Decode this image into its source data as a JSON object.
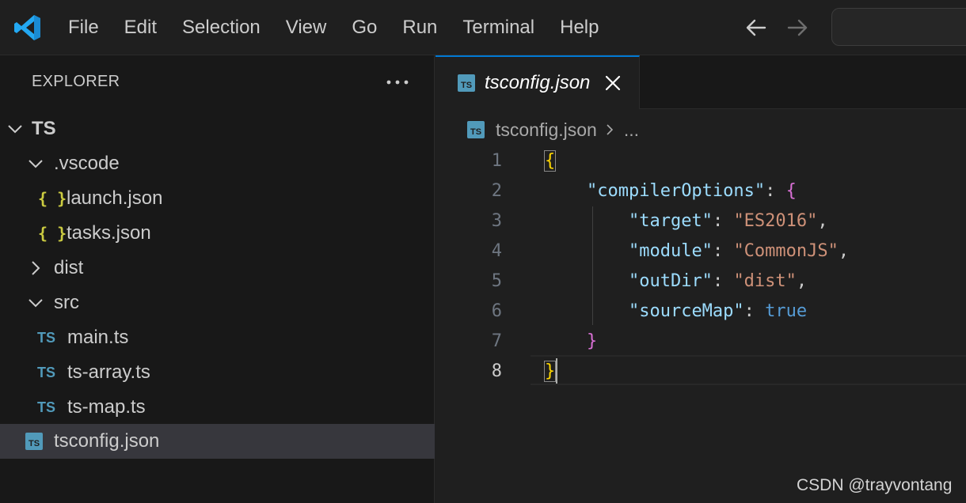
{
  "menu": {
    "items": [
      "File",
      "Edit",
      "Selection",
      "View",
      "Go",
      "Run",
      "Terminal",
      "Help"
    ]
  },
  "icons": {
    "app": "vscode-logo-icon",
    "back": "arrow-left-icon",
    "forward": "arrow-right-icon",
    "more": "ellipsis-icon",
    "close": "close-icon"
  },
  "colors": {
    "accent": "#0078d4",
    "json_icon": "#cbcb41",
    "ts_icon": "#519aba",
    "string": "#ce9178",
    "key": "#9cdcfe",
    "keyword": "#569cd6"
  },
  "sidebar": {
    "title": "EXPLORER",
    "root": "TS",
    "tree": [
      {
        "label": ".vscode",
        "type": "folder",
        "expanded": true
      },
      {
        "label": "launch.json",
        "type": "json",
        "icon": "{ }"
      },
      {
        "label": "tasks.json",
        "type": "json",
        "icon": "{ }"
      },
      {
        "label": "dist",
        "type": "folder",
        "expanded": false
      },
      {
        "label": "src",
        "type": "folder",
        "expanded": true
      },
      {
        "label": "main.ts",
        "type": "ts",
        "icon": "TS"
      },
      {
        "label": "ts-array.ts",
        "type": "ts",
        "icon": "TS"
      },
      {
        "label": "ts-map.ts",
        "type": "ts",
        "icon": "TS"
      },
      {
        "label": "tsconfig.json",
        "type": "tsconfig",
        "icon": "TS",
        "selected": true
      }
    ]
  },
  "editor": {
    "tab_label": "tsconfig.json",
    "tab_icon": "TS",
    "breadcrumb_file": "tsconfig.json",
    "breadcrumb_more": "...",
    "line_numbers": [
      "1",
      "2",
      "3",
      "4",
      "5",
      "6",
      "7",
      "8"
    ],
    "active_line": "8",
    "code": {
      "l1_brace": "{",
      "l2_key": "\"compilerOptions\"",
      "l2_colon": ": ",
      "l2_brace": "{",
      "l3_key": "\"target\"",
      "l3_colon": ": ",
      "l3_val": "\"ES2016\"",
      "l3_comma": ",",
      "l4_key": "\"module\"",
      "l4_colon": ": ",
      "l4_val": "\"CommonJS\"",
      "l4_comma": ",",
      "l5_key": "\"outDir\"",
      "l5_colon": ": ",
      "l5_val": "\"dist\"",
      "l5_comma": ",",
      "l6_key": "\"sourceMap\"",
      "l6_colon": ": ",
      "l6_val": "true",
      "l7_brace": "}",
      "l8_brace": "}"
    }
  },
  "watermark": "CSDN @trayvontang"
}
